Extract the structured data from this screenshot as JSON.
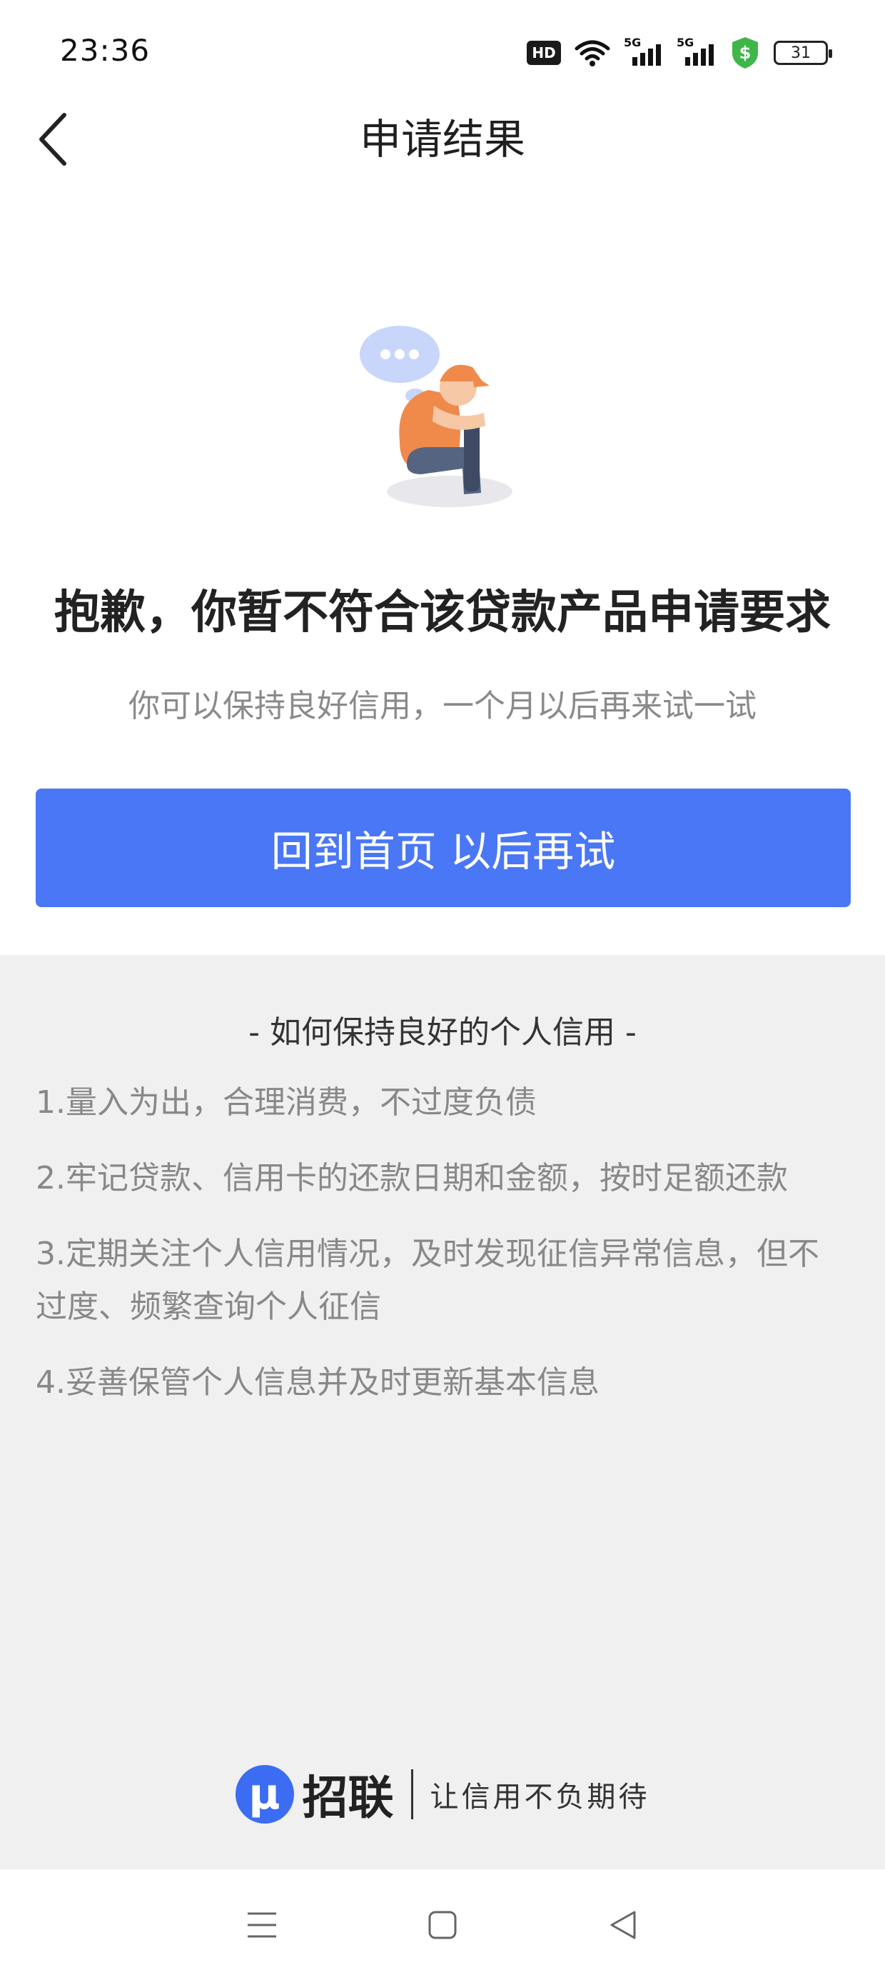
{
  "status_bar": {
    "time": "23:36",
    "hd_label": "HD",
    "signal_1_label": "5G",
    "signal_2_label": "5G",
    "battery_level": "31"
  },
  "header": {
    "title": "申请结果"
  },
  "result": {
    "title": "抱歉，你暂不符合该贷款产品申请要求",
    "subtitle": "你可以保持良好信用，一个月以后再来试一试",
    "button_label": "回到首页 以后再试"
  },
  "tips": {
    "heading": "- 如何保持良好的个人信用 -",
    "items": [
      "1.量入为出，合理消费，不过度负债",
      "2.牢记贷款、信用卡的还款日期和金额，按时足额还款",
      "3.定期关注个人信用情况，及时发现征信异常信息，但不过度、频繁查询个人征信",
      "4.妥善保管个人信息并及时更新基本信息"
    ]
  },
  "brand": {
    "logo_letter": "μ",
    "name": "招联",
    "slogan": "让信用不负期待"
  },
  "colors": {
    "primary": "#4977f6",
    "section_bg": "#f0f0f0",
    "illustration_orange": "#f08a4b",
    "illustration_bubble": "#c9d6fb"
  },
  "icons": {
    "back": "chevron-left-icon",
    "wifi": "wifi-icon",
    "shield": "shield-dollar-icon",
    "nav_menu": "menu-icon",
    "nav_home": "square-home-icon",
    "nav_back": "triangle-back-icon"
  }
}
